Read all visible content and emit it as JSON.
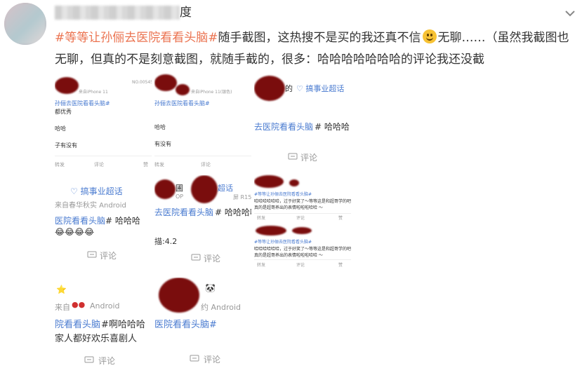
{
  "post": {
    "username_visible_suffix": "度",
    "text_topic": "#等等让孙俪去医院看看头脑#",
    "text_part1": "随手截图，这热搜不是买的我还真不信",
    "text_part2": "无聊……（虽然我截图也无聊，但真的不是刻意截图，就随手截的，很多：哈哈哈哈哈哈哈的评论我还没截"
  },
  "thumbs": {
    "t1": {
      "device": "来自iPhone 11",
      "id": "NO.00545",
      "topic": "孙俪去医院看看头脑#",
      "line1": "都优秀",
      "line2": "哈哈",
      "line3": "子有没有",
      "footer_left": "转发",
      "footer_comment": "评论",
      "footer_like": "赞"
    },
    "t2": {
      "device": "来自iPhone 11(银色)",
      "topic": "孙俪去医院看看头脑#",
      "line1": "哈哈",
      "line2": "有没有",
      "footer_left": "转发",
      "footer_comment": "评论"
    },
    "t3": {
      "name_suffix": "的",
      "badge": "搞事业超话",
      "topic": "去医院看看头脑",
      "topic_rest": "# 哈哈哈",
      "footer_comment": "评论"
    },
    "t4": {
      "badge": "搞事业超话",
      "source": "来自春华秋实 Android",
      "topic": "医院看看头脑",
      "topic_rest": "# 哈哈哈",
      "emojis": "😂😂😂😂",
      "footer_comment": "评论"
    },
    "t5": {
      "name": "圃",
      "badge": "超话",
      "device": "OP",
      "device2": "屏 R15",
      "topic": "去医院看看头脑",
      "topic_rest": "# 哈哈哈哈",
      "rating": "描:4.2",
      "footer_comment": "评论"
    },
    "t6": {
      "c1_topic": "#等等让孙俪去医院看看头脑#",
      "c1_text1": "哈哈哈哈哈哈，过于好笑了～等等这是和超哥学的吧,",
      "c1_text2": "真的是超哥养出的表情啦啦啦哈哈 ～",
      "c2_topic": "#等等让孙俪去医院看看头脑#",
      "c2_text1": "哈哈哈哈哈哈，过于好笑了～等等这是和超哥学的吧,",
      "c2_text2": "真的是超哥养出的表情啦啦啦哈哈 ～",
      "footer_left": "转发",
      "footer_comment": "评论",
      "footer_like": "赞"
    },
    "t7": {
      "source_prefix": "来自",
      "source": "Android",
      "topic": "院看看头脑",
      "topic_rest": "#啊哈哈哈",
      "line2": "家人都好欢乐喜剧人",
      "footer_comment": "评论"
    },
    "t8": {
      "source": "约 Android",
      "topic": "医院看看头脑#",
      "footer_comment": "评论"
    }
  }
}
